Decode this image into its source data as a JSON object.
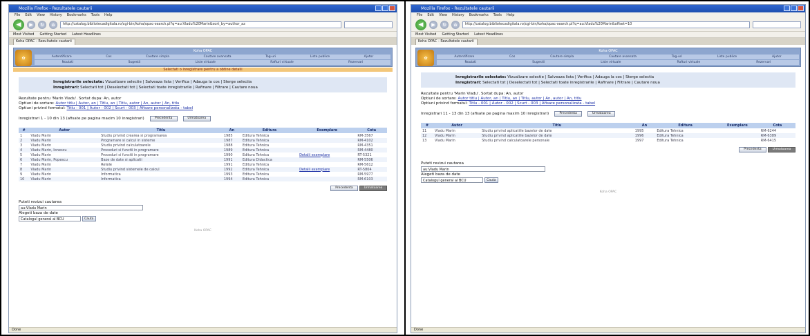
{
  "left": {
    "window_title": "Mozilla Firefox - Rezultatele cautarii",
    "menu": [
      "File",
      "Edit",
      "View",
      "History",
      "Bookmarks",
      "Tools",
      "Help"
    ],
    "url": "http://catalog.bibliotecadigitala.ro/cgi-bin/koha/opac-search.pl?q=au:Vladu%20Marin&sort_by=author_az",
    "bookmarks": [
      "Most Visited",
      "Getting Started",
      "Latest Headlines"
    ],
    "tab": "Koha OPAC - Rezultatele cautarii",
    "opac_title": "Koha OPAC",
    "nav_row1": [
      "Autentificare",
      "Cos",
      "Cautare simpla",
      "Cautare avansata",
      "Tag-uri",
      "Liste publice",
      "Ajutor"
    ],
    "nav_row2": [
      "Noutati",
      "Sugestii",
      "Liste virtuale",
      "Rafturi virtuale",
      "Rezervari"
    ],
    "notice": "Selectati o inregistrare pentru a obtine detalii",
    "selected_label": "Inregistrarile selectate:",
    "selected_actions": "Vizualizare selectie | Salveaza lista | Verifica | Adauga la cos | Sterge selectia",
    "found_label": "Inregistrari:",
    "found_actions": "Selectati tot | Deselectati tot | Selectati toate inregistrarile | Rafinare | Filtrare | Cautare noua",
    "query_line": "Rezultate pentru 'Marin Vladu'. Sortat dupa: An, autor",
    "sort_label": "Optiuni de sortare:",
    "sort_links": "Autor titlu | Autor, an | Titlu, an | Titlu, autor | An, autor | An, titlu",
    "format_label": "Optiuni privind formatul:",
    "format_links": "Titlu - 001 | Autor - 002 | Scurt - 003 | Afisare personalizata - tabel",
    "range": "Inregistrari 1 - 10 din 13 (afisate pe pagina maxim 10 inregistrari)",
    "prev_btn": "Precedenta",
    "next_btn": "Urmatoarea",
    "cols": [
      "#",
      "Autor",
      "Titlu",
      "An",
      "Editura",
      "Exemplare",
      "Cota"
    ],
    "rows": [
      [
        "1",
        "Vladu Marin",
        "Studiu privind crearea si programarea",
        "1985",
        "Editura Tehnica",
        "",
        "RM-3567"
      ],
      [
        "2",
        "Vladu Marin",
        "Programare si calcul in sisteme",
        "1987",
        "Editura Tehnica",
        "",
        "RM-4102"
      ],
      [
        "3",
        "Vladu Marin",
        "Studiu privind calculatoarele",
        "1988",
        "Editura Tehnica",
        "",
        "RM-4351"
      ],
      [
        "4",
        "Vladu Marin, Ionescu",
        "Proceduri si functii in programare",
        "1989",
        "Editura Tehnica",
        "",
        "RM-4480"
      ],
      [
        "5",
        "Vladu Marin",
        "Proceduri si functii in programare",
        "1990",
        "Editura Tehnica",
        "Detalii exemplare",
        "RT-5321"
      ],
      [
        "6",
        "Vladu Marin, Popescu",
        "Baze de date si aplicatii",
        "1991",
        "Editura Didactica",
        "",
        "RM-5506"
      ],
      [
        "7",
        "Vladu Marin",
        "Retele",
        "1991",
        "Editura Tehnica",
        "",
        "RM-5612"
      ],
      [
        "8",
        "Vladu Marin",
        "Studiu privind sistemele de calcul",
        "1992",
        "Editura Tehnica",
        "Detalii exemplare",
        "RT-5804"
      ],
      [
        "9",
        "Vladu Marin",
        "Informatica",
        "1993",
        "Editura Tehnica",
        "",
        "RM-5977"
      ],
      [
        "10",
        "Vladu Marin",
        "Informatica",
        "1994",
        "Editura Tehnica",
        "",
        "RM-6103"
      ]
    ],
    "refine_label": "Puteti revizui cautarea",
    "refine_value": "au:Vladu Marin",
    "db_label": "Alegeti baza de date",
    "db_value": "Catalogul general al BCU",
    "go_btn": "Cauta",
    "footer_note": "Koha OPAC",
    "status": "Done"
  },
  "right": {
    "window_title": "Mozilla Firefox - Rezultatele cautarii",
    "menu": [
      "File",
      "Edit",
      "View",
      "History",
      "Bookmarks",
      "Tools",
      "Help"
    ],
    "url": "http://catalog.bibliotecadigitala.ro/cgi-bin/koha/opac-search.pl?q=au:Vladu%20Marin&offset=10",
    "bookmarks": [
      "Most Visited",
      "Getting Started",
      "Latest Headlines"
    ],
    "tab": "Koha OPAC - Rezultatele cautarii",
    "opac_title": "Koha OPAC",
    "nav_row1": [
      "Autentificare",
      "Cos",
      "Cautare simpla",
      "Cautare avansata",
      "Tag-uri",
      "Liste publice",
      "Ajutor"
    ],
    "nav_row2": [
      "Noutati",
      "Sugestii",
      "Liste virtuale",
      "Rafturi virtuale",
      "Rezervari"
    ],
    "selected_label": "Inregistrarile selectate:",
    "selected_actions": "Vizualizare selectie | Salveaza lista | Verifica | Adauga la cos | Sterge selectia",
    "found_label": "Inregistrari:",
    "found_actions": "Selectati tot | Deselectati tot | Selectati toate inregistrarile | Rafinare | Filtrare | Cautare noua",
    "query_line": "Rezultate pentru 'Marin Vladu'. Sortat dupa: An, autor",
    "sort_label": "Optiuni de sortare:",
    "sort_links": "Autor titlu | Autor, an | Titlu, an | Titlu, autor | An, autor | An, titlu",
    "format_label": "Optiuni privind formatul:",
    "format_links": "Titlu - 001 | Autor - 002 | Scurt - 003 | Afisare personalizata - tabel",
    "range": "Inregistrari 11 - 13 din 13 (afisate pe pagina maxim 10 inregistrari)",
    "prev_btn": "Precedenta",
    "next_btn": "Urmatoarea",
    "cols": [
      "#",
      "Autor",
      "Titlu",
      "An",
      "Editura",
      "Exemplare",
      "Cota"
    ],
    "rows": [
      [
        "11",
        "Vladu Marin",
        "Studiu privind aplicatiile bazelor de date",
        "1995",
        "Editura Tehnica",
        "",
        "RM-6244"
      ],
      [
        "12",
        "Vladu Marin",
        "Studiu privind aplicatiile bazelor de date",
        "1996",
        "Editura Tehnica",
        "",
        "RM-6389"
      ],
      [
        "13",
        "Vladu Marin",
        "Studiu privind calculatoarele personale",
        "1997",
        "Editura Tehnica",
        "",
        "RM-6415"
      ]
    ],
    "refine_label": "Puteti revizui cautarea",
    "refine_value": "au:Vladu Marin",
    "db_label": "Alegeti baza de date",
    "db_value": "Catalogul general al BCU",
    "go_btn": "Cauta",
    "footer_note": "Koha OPAC",
    "status": "Done"
  }
}
